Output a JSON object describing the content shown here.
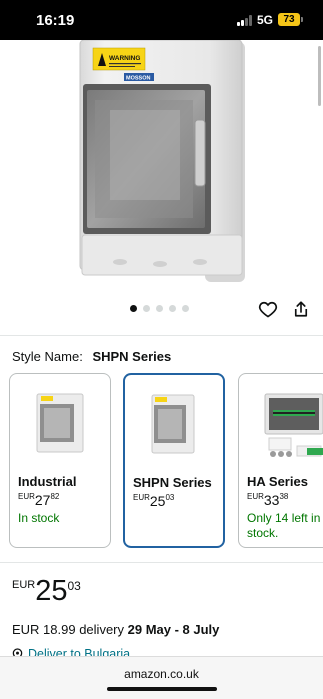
{
  "status_bar": {
    "time": "16:19",
    "network": "5G",
    "battery": "73"
  },
  "product": {
    "image_icon": "electrical-enclosure-image",
    "warning_label": "WARNING",
    "brand_label": "MOSSON",
    "gallery": {
      "count": 5,
      "active_index": 0
    },
    "style_label": "Style Name:",
    "style_value": "SHPN Series",
    "variants": [
      {
        "name": "Industrial",
        "currency": "EUR",
        "whole": "27",
        "cents": "82",
        "stock": "In stock",
        "selected": false
      },
      {
        "name": "SHPN Series",
        "currency": "EUR",
        "whole": "25",
        "cents": "03",
        "stock": "",
        "selected": true
      },
      {
        "name": "HA Series",
        "currency": "EUR",
        "whole": "33",
        "cents": "38",
        "stock": "Only 14 left in stock.",
        "selected": false
      }
    ],
    "price": {
      "currency": "EUR",
      "whole": "25",
      "cents": "03"
    },
    "delivery": {
      "prefix": "EUR 18.99 delivery",
      "dates": "29 May - 8 July"
    },
    "deliver_to": "Deliver to Bulgaria"
  },
  "browser": {
    "url": "amazon.co.uk"
  },
  "colors": {
    "selected_border": "#2162a1",
    "in_stock": "#007600",
    "link": "#007185"
  }
}
